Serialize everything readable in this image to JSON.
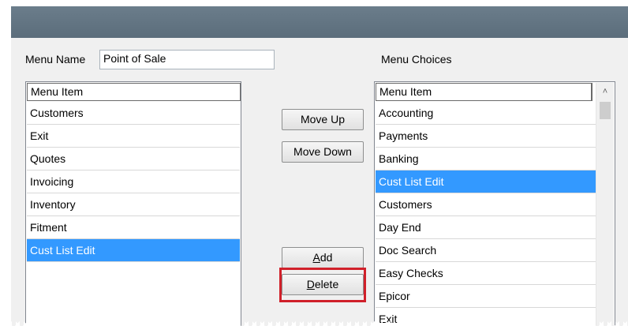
{
  "menu_name": {
    "label": "Menu Name",
    "value": "Point of Sale"
  },
  "menu_items": {
    "header": "Menu Item",
    "rows": [
      "Customers",
      "Exit",
      "Quotes",
      "Invoicing",
      "Inventory",
      "Fitment",
      "Cust List Edit"
    ],
    "selected_index": 6
  },
  "buttons": {
    "move_up": "Move Up",
    "move_down": "Move Down",
    "add_accel": "A",
    "add_rest": "dd",
    "delete_accel": "D",
    "delete_rest": "elete"
  },
  "menu_choices": {
    "label": "Menu Choices",
    "header": "Menu Item",
    "rows": [
      "Accounting",
      "Payments",
      "Banking",
      "Cust List Edit",
      "Customers",
      "Day End",
      "Doc Search",
      "Easy Checks",
      "Epicor",
      "Exit"
    ],
    "selected_index": 3
  },
  "colors": {
    "titlebar": "#5f717f",
    "selection": "#3399ff",
    "callout": "#d0202a"
  },
  "icons": {
    "scroll_up": "chevron-up-icon"
  }
}
